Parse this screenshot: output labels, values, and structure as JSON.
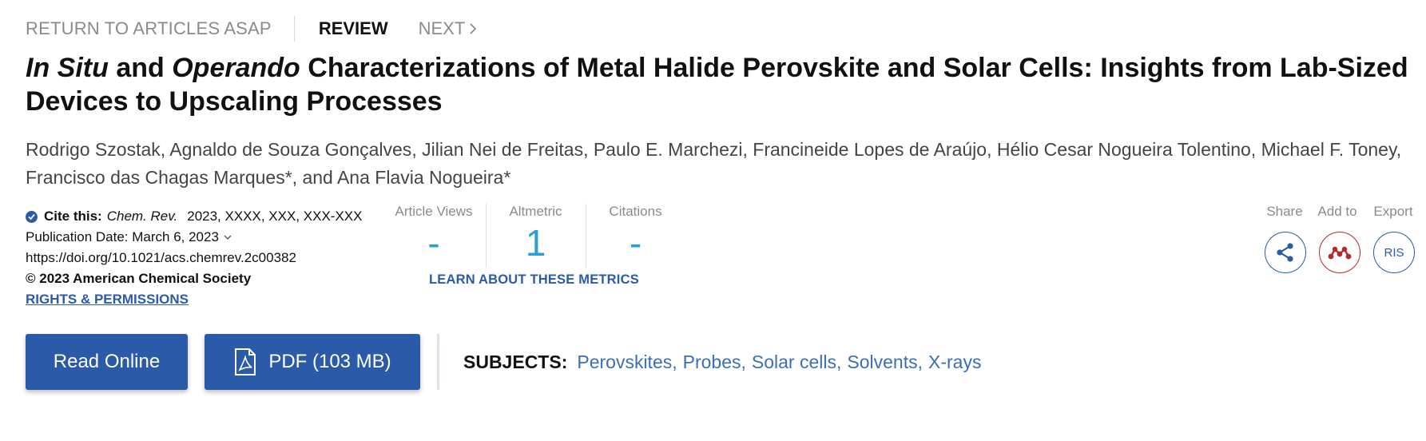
{
  "nav": {
    "return_label": "RETURN TO ARTICLES ASAP",
    "article_type": "REVIEW",
    "next_label": "NEXT"
  },
  "article": {
    "title_part1": "In Situ",
    "title_part2": " and ",
    "title_part3": "Operando",
    "title_part4": " Characterizations of Metal Halide Perovskite and Solar Cells: Insights from Lab-Sized Devices to Upscaling Processes",
    "authors": [
      "Rodrigo Szostak",
      "Agnaldo de Souza Gonçalves",
      "Jilian Nei de Freitas",
      "Paulo E. Marchezi",
      "Francineide Lopes de Araújo",
      "Hélio Cesar Nogueira Tolentino",
      "Michael F. Toney",
      "Francisco das Chagas Marques*",
      "Ana Flavia Nogueira*"
    ],
    "author_separator": ", ",
    "author_and": ", and "
  },
  "citation": {
    "cite_label": "Cite this:",
    "journal": "Chem. Rev.",
    "cite_rest": "2023, XXXX, XXX, XXX-XXX",
    "pub_date": "Publication Date: March 6, 2023",
    "doi": "https://doi.org/10.1021/acs.chemrev.2c00382",
    "copyright": "© 2023 American Chemical Society",
    "rights_link": "RIGHTS & PERMISSIONS"
  },
  "metrics": {
    "article_views_label": "Article Views",
    "article_views_value": "-",
    "altmetric_label": "Altmetric",
    "altmetric_value": "1",
    "citations_label": "Citations",
    "citations_value": "-",
    "learn_link": "LEARN ABOUT THESE METRICS"
  },
  "actions": {
    "share_label": "Share",
    "add_label": "Add to",
    "export_label": "Export",
    "export_button": "RIS"
  },
  "buttons": {
    "read_online": "Read Online",
    "pdf": "PDF (103 MB)"
  },
  "subjects": {
    "label": "SUBJECTS:",
    "items": [
      "Perovskites",
      "Probes",
      "Solar cells",
      "Solvents",
      "X-rays"
    ]
  },
  "colors": {
    "accent": "#2a5aa8",
    "metric_value": "#2a9fd6",
    "mendeley": "#b22a2a"
  }
}
